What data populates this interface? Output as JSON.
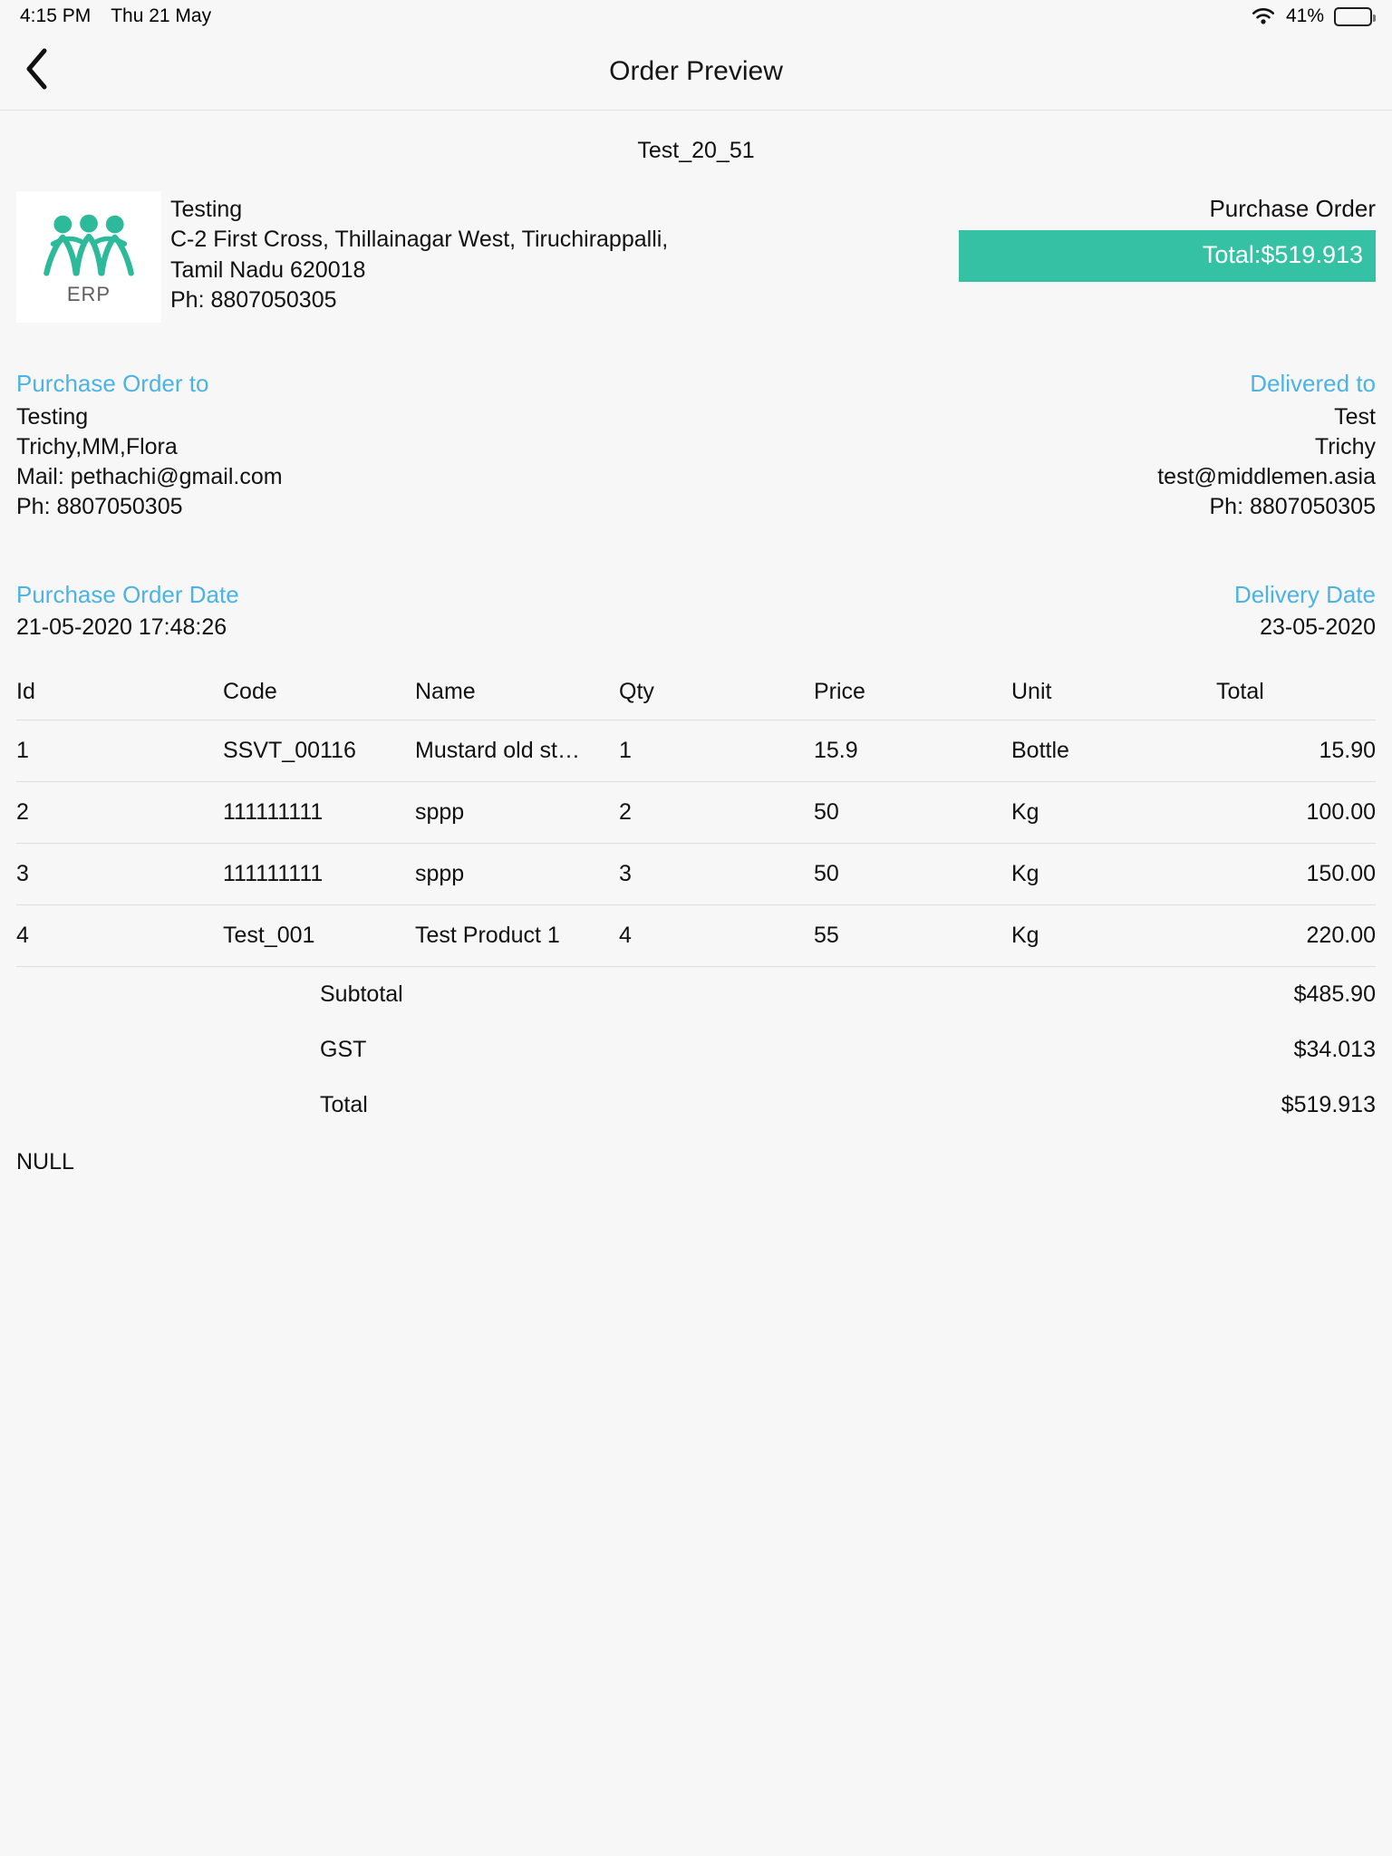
{
  "statusbar": {
    "time": "4:15 PM",
    "date": "Thu 21 May",
    "wifi_icon": "wifi-icon",
    "battery_percent": "41%",
    "battery_level": 41
  },
  "navbar": {
    "back_icon": "chevron-left-icon",
    "title": "Order Preview"
  },
  "document": {
    "reference": "Test_20_51",
    "company": {
      "logo_text": "ERP",
      "name": "Testing",
      "address_line1": " C-2 First Cross, Thillainagar West, Tiruchirappalli,",
      "address_line2": "Tamil Nadu 620018",
      "phone": "Ph: 8807050305"
    },
    "order_type_label": "Purchase Order",
    "order_total_badge": "Total:$519.913",
    "badge_color": "#35c1a3",
    "accent_color": "#4cb3e4",
    "bill_to": {
      "heading": "Purchase Order to",
      "name": "Testing",
      "address": "Trichy,MM,Flora",
      "mail": "Mail: pethachi@gmail.com",
      "phone": "Ph: 8807050305"
    },
    "deliver_to": {
      "heading": "Delivered to",
      "name": "Test",
      "address": "Trichy",
      "mail": "test@middlemen.asia",
      "phone": "Ph: 8807050305"
    },
    "order_date": {
      "heading": "Purchase Order Date",
      "value": "21-05-2020 17:48:26"
    },
    "delivery_date": {
      "heading": "Delivery Date",
      "value": "23-05-2020"
    },
    "table": {
      "headers": [
        "Id",
        "Code",
        "Name",
        "Qty",
        "Price",
        "Unit",
        "Total"
      ],
      "rows": [
        {
          "id": "1",
          "code": "SSVT_00116",
          "name": "Mustard old st…",
          "qty": "1",
          "price": "15.9",
          "unit": "Bottle",
          "total": "15.90"
        },
        {
          "id": "2",
          "code": "111111111",
          "name": "sppp",
          "qty": "2",
          "price": "50",
          "unit": "Kg",
          "total": "100.00"
        },
        {
          "id": "3",
          "code": "111111111",
          "name": "sppp",
          "qty": "3",
          "price": "50",
          "unit": "Kg",
          "total": "150.00"
        },
        {
          "id": "4",
          "code": "Test_001",
          "name": "Test Product 1",
          "qty": "4",
          "price": "55",
          "unit": "Kg",
          "total": "220.00"
        }
      ]
    },
    "summary": {
      "subtotal_label": "Subtotal",
      "subtotal_value": "$485.90",
      "gst_label": "GST",
      "gst_value": "$34.013",
      "total_label": "Total",
      "total_value": "$519.913"
    },
    "footer_note": "NULL"
  }
}
